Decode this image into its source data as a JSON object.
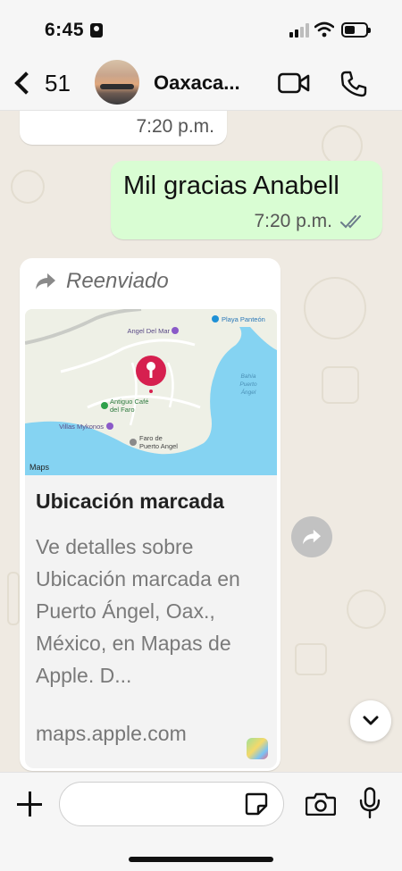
{
  "status_bar": {
    "time": "6:45"
  },
  "header": {
    "back_count": "51",
    "chat_title": "Oaxaca..."
  },
  "messages": {
    "partial_incoming": {
      "time": "7:20 p.m."
    },
    "outgoing": {
      "text": "Mil gracias Anabell",
      "time": "7:20 p.m.",
      "read_receipt_icon": "double-check-icon"
    },
    "forwarded_location": {
      "forwarded_label": "Reenviado",
      "map": {
        "labels": [
          "Angel Del Mar",
          "Playa Panteón",
          "Antiguo Café",
          "del Faro",
          "Villas Mykonos",
          "Faro de",
          "Puerto Angel",
          "Bahía",
          "Puerto",
          "Ángel"
        ],
        "attribution": "Maps"
      },
      "title": "Ubicación marcada",
      "description": "Ve detalles sobre Ubicación marcada en Puerto Ángel, Oax., México, en Mapas de Apple. D...",
      "domain": "maps.apple.com"
    }
  },
  "composer": {
    "placeholder": ""
  },
  "colors": {
    "outgoing_bubble": "#d9fdd3",
    "pin": "#d6204f",
    "water": "#85d3f2",
    "receipt_blue": "#6b7b8a"
  }
}
